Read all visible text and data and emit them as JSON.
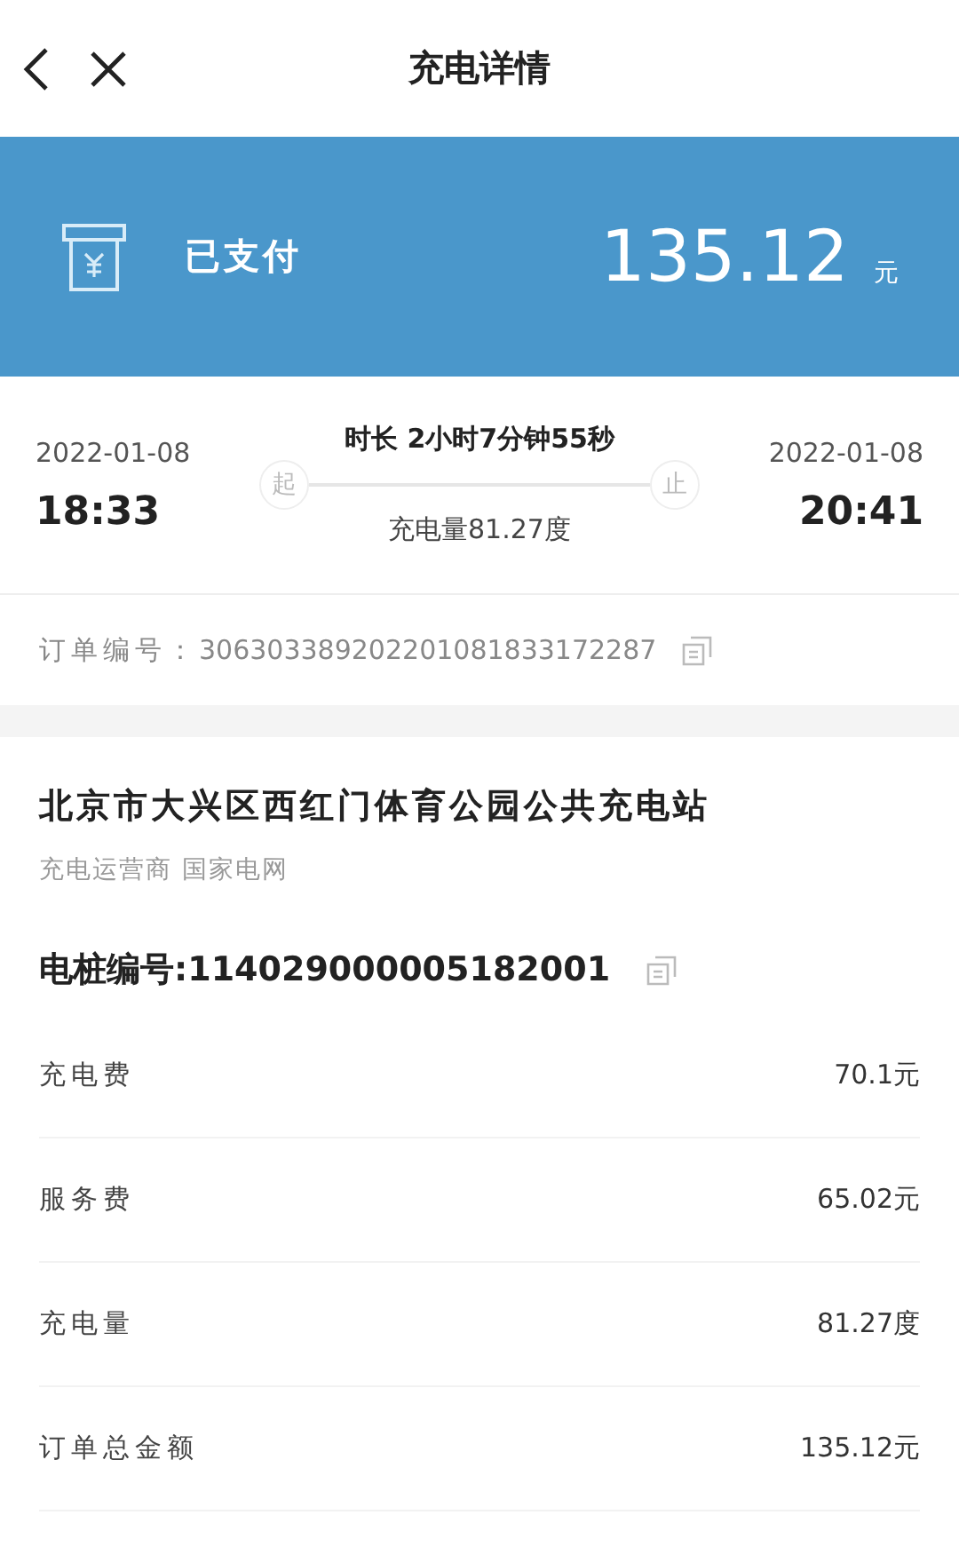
{
  "header": {
    "title": "充电详情"
  },
  "payment": {
    "status": "已支付",
    "amount": "135.12",
    "unit": "元"
  },
  "session": {
    "start_date": "2022-01-08",
    "start_time": "18:33",
    "start_mark": "起",
    "duration": "时长 2小时7分钟55秒",
    "energy": "充电量81.27度",
    "end_mark": "止",
    "end_date": "2022-01-08",
    "end_time": "20:41"
  },
  "order": {
    "label": "订单编号：",
    "number": "306303389202201081833172287"
  },
  "station": {
    "name": "北京市大兴区西红门体育公园公共充电站",
    "operator": "充电运营商 国家电网",
    "pile": "电桩编号:114029000005182001"
  },
  "fees": [
    {
      "label": "充电费",
      "value": "70.1元"
    },
    {
      "label": "服务费",
      "value": "65.02元"
    },
    {
      "label": "充电量",
      "value": "81.27度"
    },
    {
      "label": "订单总金额",
      "value": "135.12元"
    }
  ]
}
